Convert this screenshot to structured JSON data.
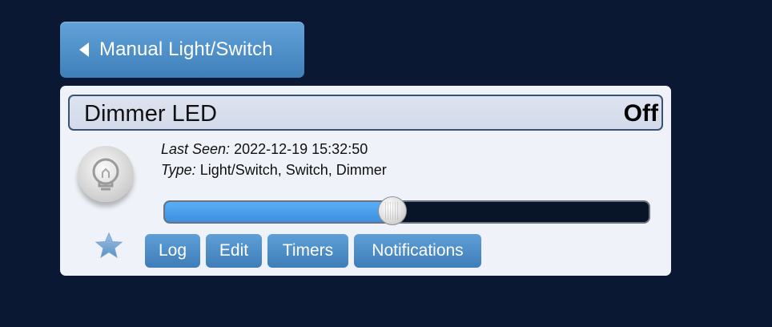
{
  "nav": {
    "back_label": "Manual Light/Switch"
  },
  "device": {
    "name": "Dimmer LED",
    "status": "Off",
    "last_seen_label": "Last Seen:",
    "last_seen_value": "2022-12-19 15:32:50",
    "type_label": "Type:",
    "type_value": "Light/Switch, Switch, Dimmer",
    "level_fraction": 0.47,
    "icon": "lightbulb-icon",
    "favorite_icon": "star-icon"
  },
  "actions": {
    "log": "Log",
    "edit": "Edit",
    "timers": "Timers",
    "notifications": "Notifications"
  },
  "colors": {
    "page_background": "#0a1833",
    "button_blue": "#4a89c4",
    "slider_fill": "#4a9cec",
    "card_background": "#eff2f8"
  }
}
